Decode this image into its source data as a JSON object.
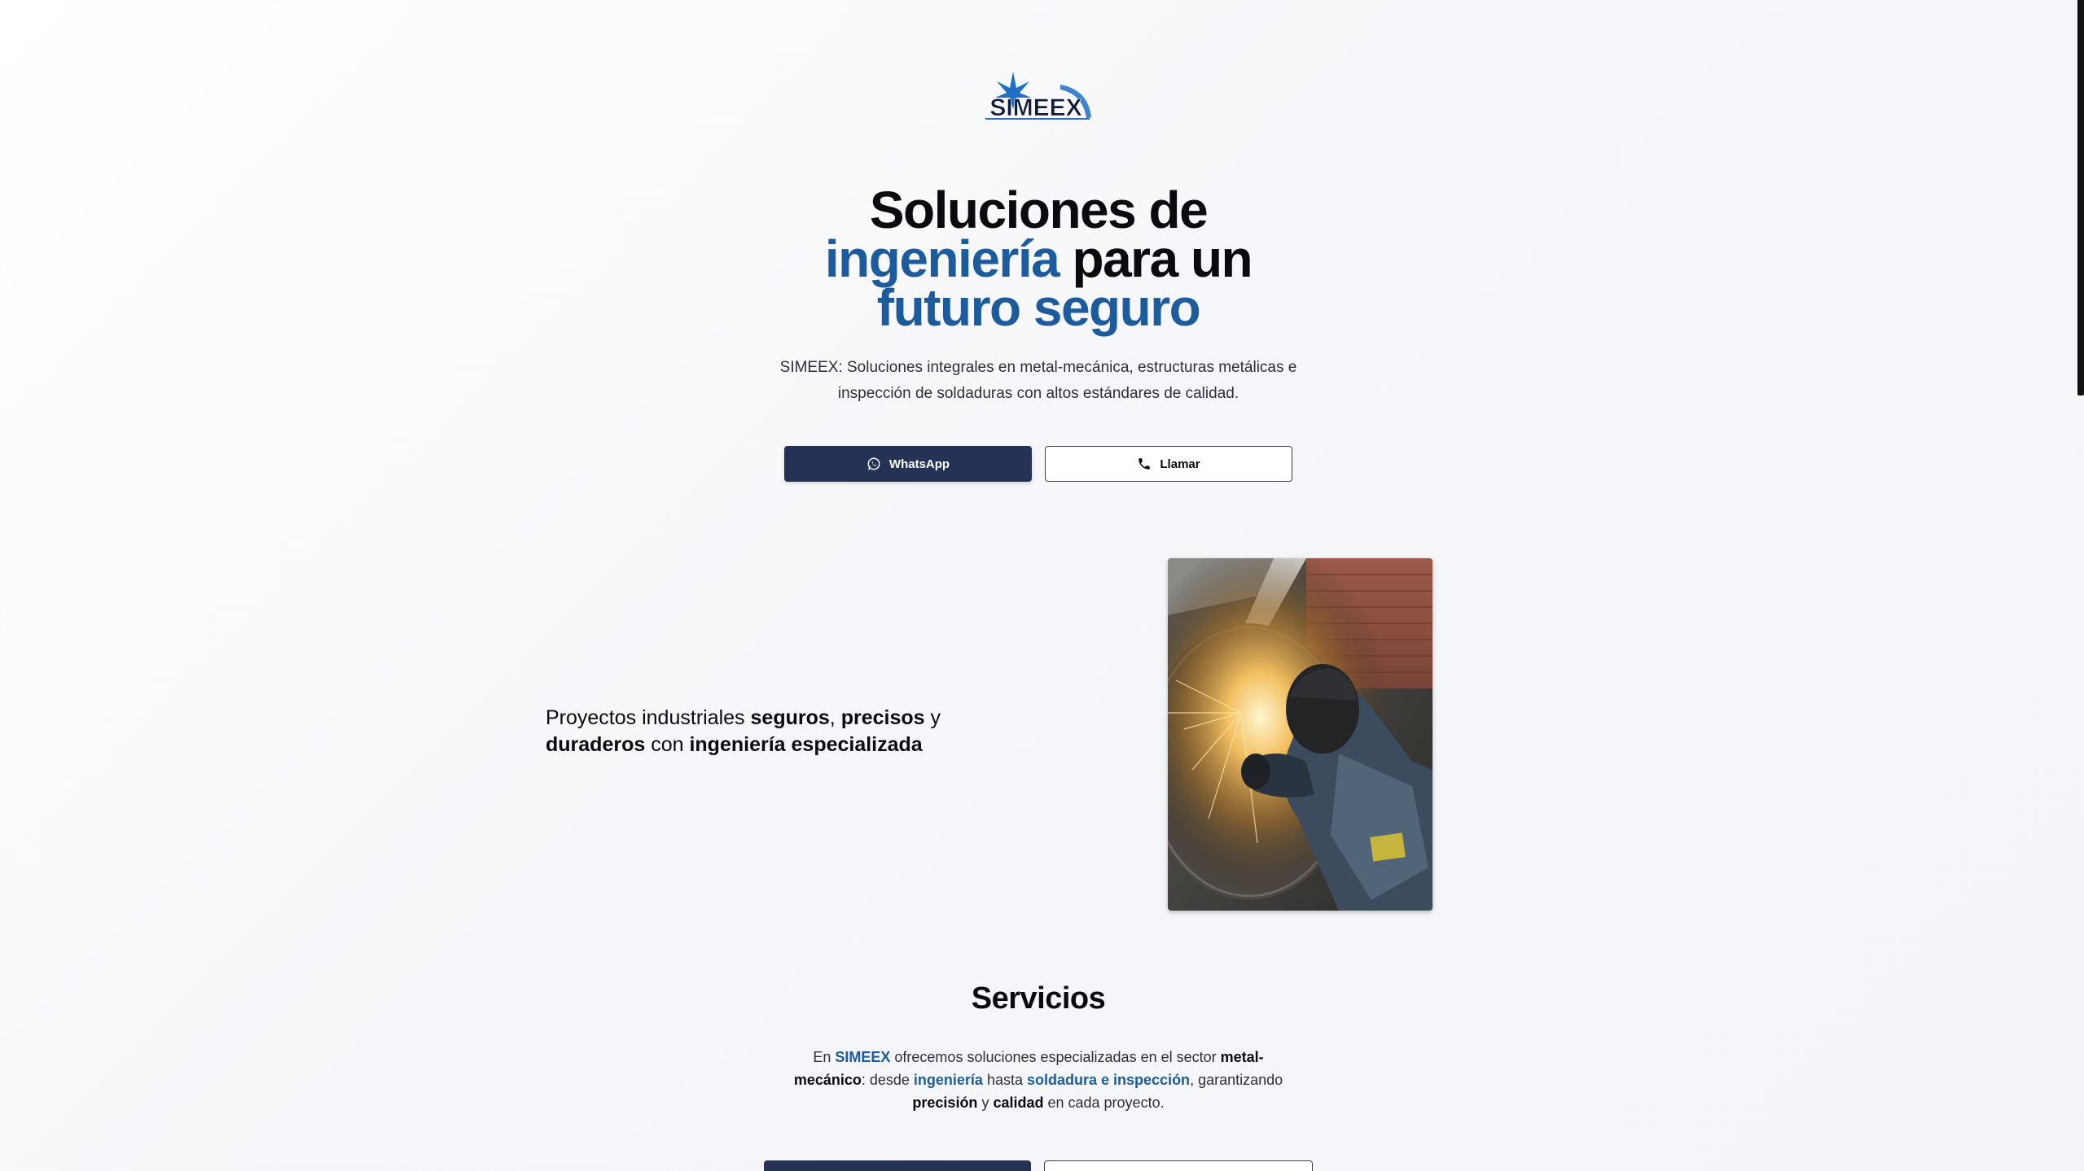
{
  "brand": {
    "logo_text": "SIMEEX",
    "colors": {
      "accent": "#1c5c9e",
      "primary_button": "#253256",
      "logo_star": "#1f6fc4"
    }
  },
  "hero": {
    "title_line1": "Soluciones de",
    "title_accent1": "ingeniería",
    "title_mid": " para un",
    "title_accent2": "futuro seguro",
    "subtitle": "SIMEEX: Soluciones integrales en metal-mecánica, estructuras metálicas e inspección de soldaduras con altos estándares de calidad.",
    "whatsapp_label": "WhatsApp",
    "whatsapp_icon": "whatsapp-icon",
    "call_label": "Llamar",
    "call_icon": "phone-icon"
  },
  "feature": {
    "text_1": "Proyectos industriales ",
    "bold_1": "seguros",
    "text_2": ", ",
    "bold_2": "precisos",
    "text_3": " y ",
    "bold_3": "duraderos",
    "text_4": " con ",
    "bold_4": "ingeniería especializada"
  },
  "services": {
    "title": "Servicios",
    "d1": "En ",
    "d2": "SIMEEX",
    "d3": " ofrecemos soluciones especializadas en el sector ",
    "d4": "metal-mecánico",
    "d5": ": desde ",
    "d6": "ingeniería",
    "d7": " hasta ",
    "d8": "soldadura e inspección",
    "d9": ", garantizando ",
    "d10": "precisión",
    "d11": " y ",
    "d12": "calidad",
    "d13": " en cada proyecto."
  }
}
